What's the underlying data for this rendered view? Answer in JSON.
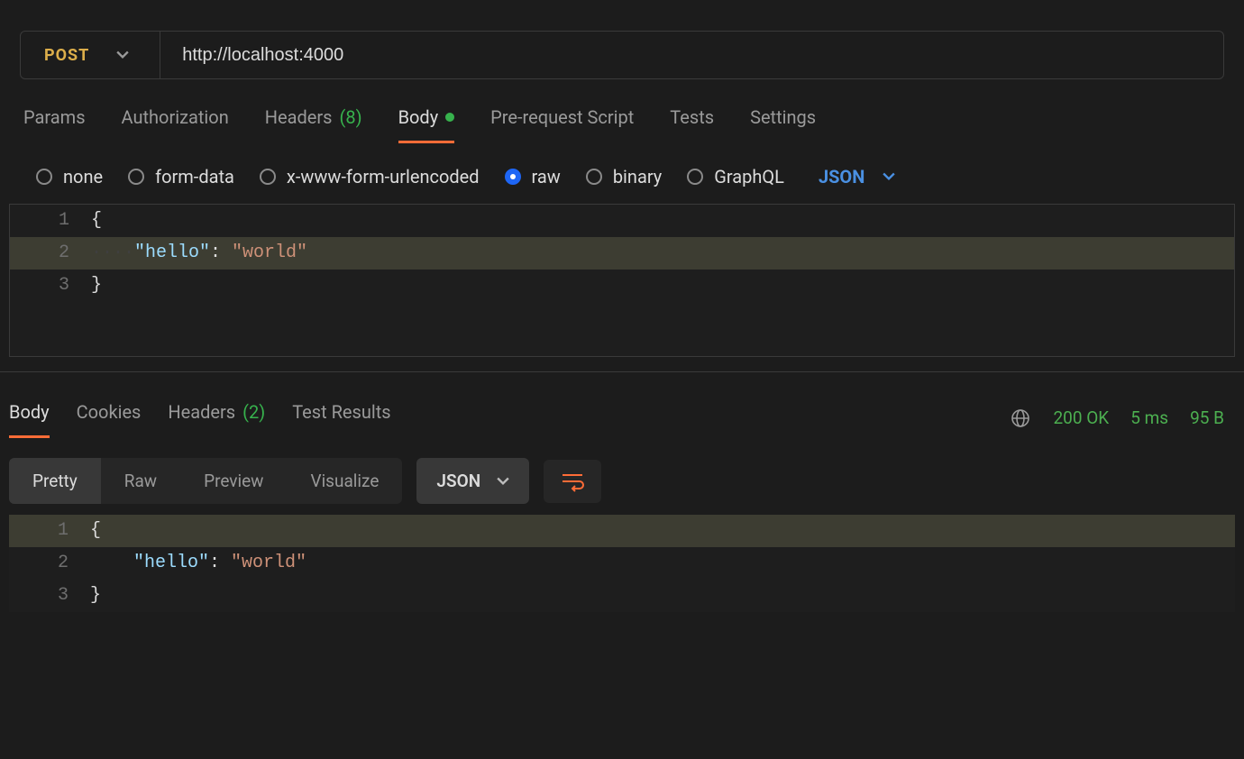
{
  "request": {
    "method": "POST",
    "url": "http://localhost:4000",
    "tabs": {
      "params": "Params",
      "authorization": "Authorization",
      "headers_label": "Headers",
      "headers_count": "(8)",
      "body": "Body",
      "prerequest": "Pre-request Script",
      "tests": "Tests",
      "settings": "Settings"
    },
    "body_types": {
      "none": "none",
      "form_data": "form-data",
      "urlencoded": "x-www-form-urlencoded",
      "raw": "raw",
      "binary": "binary",
      "graphql": "GraphQL",
      "format": "JSON"
    },
    "editor": {
      "line1": "{",
      "line2_key": "\"hello\"",
      "line2_colon": ": ",
      "line2_val": "\"world\"",
      "line3": "}"
    }
  },
  "response": {
    "tabs": {
      "body": "Body",
      "cookies": "Cookies",
      "headers_label": "Headers",
      "headers_count": "(2)",
      "test_results": "Test Results"
    },
    "status_code": "200 OK",
    "time": "5 ms",
    "size": "95 B",
    "view_modes": {
      "pretty": "Pretty",
      "raw": "Raw",
      "preview": "Preview",
      "visualize": "Visualize"
    },
    "format": "JSON",
    "editor": {
      "line1": "{",
      "line2_key": "\"hello\"",
      "line2_colon": ": ",
      "line2_val": "\"world\"",
      "line3": "}"
    }
  }
}
